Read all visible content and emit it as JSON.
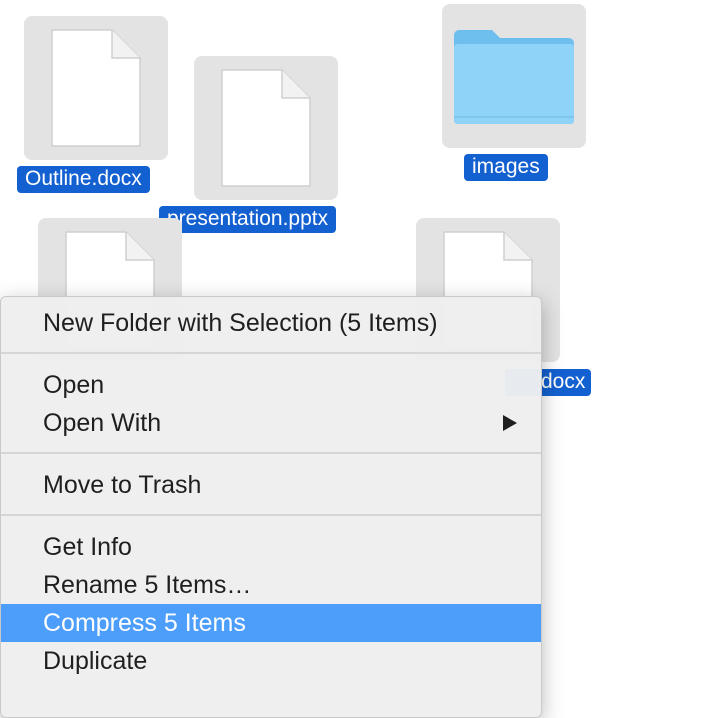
{
  "desktop": {
    "files": [
      {
        "name": "Outline.docx",
        "type": "document"
      },
      {
        "name": "presentation.pptx",
        "type": "document"
      },
      {
        "name": "images",
        "type": "folder"
      },
      {
        "name": "",
        "type": "document"
      },
      {
        "name": "docx",
        "type": "document"
      }
    ],
    "colors": {
      "selection_label": "#1360d0",
      "icon_tile": "#e3e3e3",
      "folder": "#7fcaf5"
    }
  },
  "context_menu": {
    "highlighted_item": "Compress 5 Items",
    "highlight_color": "#4d9dfb",
    "items": [
      {
        "label": "New Folder with Selection (5 Items)"
      },
      {
        "label": "Open"
      },
      {
        "label": "Open With",
        "icon": "submenu-arrow-icon"
      },
      {
        "label": "Move to Trash"
      },
      {
        "label": "Get Info"
      },
      {
        "label": "Rename 5 Items…"
      },
      {
        "label": "Compress 5 Items"
      },
      {
        "label": "Duplicate"
      }
    ]
  }
}
